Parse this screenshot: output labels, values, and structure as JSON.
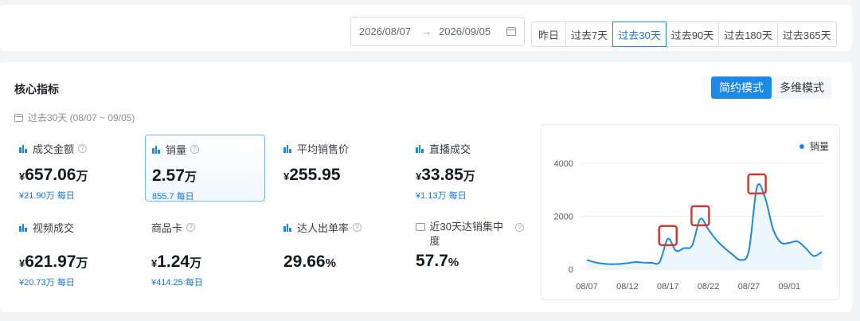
{
  "header": {
    "date_start": "2026/08/07",
    "date_end": "2026/09/05",
    "arrow": "→",
    "periods": [
      "昨日",
      "过去7天",
      "过去30天",
      "过去90天",
      "过去180天",
      "过去365天"
    ],
    "active_period": "过去30天"
  },
  "panel": {
    "title": "核心指标",
    "mode_simple": "简约模式",
    "mode_multi": "多维模式",
    "range_label": "过去30天 (08/07 ~ 09/05)"
  },
  "metrics": [
    {
      "label": "成交金额",
      "value": "657.06",
      "unit": "万",
      "yen": "¥",
      "sub": "¥21.90万 每日",
      "help": "?"
    },
    {
      "label": "销量",
      "value": "2.57",
      "unit": "万",
      "sub": "855.7 每日",
      "help": "?"
    },
    {
      "label": "平均销售价",
      "value": "255.95",
      "yen": "¥"
    },
    {
      "label": "直播成交",
      "value": "33.85",
      "unit": "万",
      "yen": "¥",
      "sub": "¥1.13万 每日"
    },
    {
      "label": "视频成交",
      "value": "621.97",
      "unit": "万",
      "yen": "¥",
      "sub": "¥20.73万 每日"
    },
    {
      "label": "商品卡",
      "value": "1.24",
      "unit": "万",
      "yen": "¥",
      "sub": "¥414.25 每日",
      "help": "?"
    },
    {
      "label": "达人出单率",
      "value": "29.66",
      "unit": "%",
      "help": "?"
    },
    {
      "label": "近30天达销集中度",
      "value": "57.7",
      "unit": "%",
      "help": "?"
    }
  ],
  "chart_data": {
    "type": "line",
    "legend": "销量",
    "legend_position": "top-right",
    "color": "#1e88e5",
    "yticks": [
      "0",
      "2000",
      "4000"
    ],
    "ylim": [
      0,
      4000
    ],
    "xticks": [
      "08/07",
      "08/12",
      "08/17",
      "08/22",
      "08/27",
      "09/01"
    ],
    "x": [
      "08/07",
      "08/08",
      "08/09",
      "08/10",
      "08/11",
      "08/12",
      "08/13",
      "08/14",
      "08/15",
      "08/16",
      "08/17",
      "08/18",
      "08/19",
      "08/20",
      "08/21",
      "08/22",
      "08/23",
      "08/24",
      "08/25",
      "08/26",
      "08/27",
      "08/28",
      "08/29",
      "08/30",
      "08/31",
      "09/01",
      "09/02",
      "09/03",
      "09/04",
      "09/05"
    ],
    "values": [
      350,
      260,
      210,
      190,
      200,
      230,
      270,
      250,
      240,
      280,
      1150,
      700,
      800,
      900,
      1900,
      1500,
      1100,
      800,
      550,
      350,
      700,
      3100,
      2700,
      1500,
      1000,
      1000,
      1050,
      800,
      500,
      650
    ],
    "highlights": [
      "08/17",
      "08/21",
      "08/28"
    ]
  }
}
